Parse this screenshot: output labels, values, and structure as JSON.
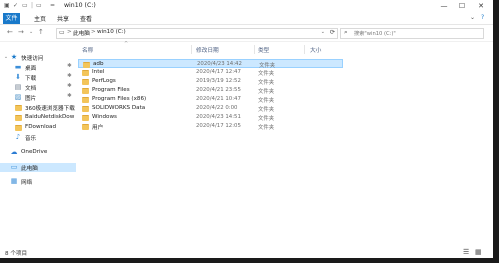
{
  "window": {
    "title": "win10 (C:)",
    "quick_access_icons": [
      "save-icon",
      "properties-icon",
      "new-folder-icon"
    ],
    "controls": {
      "minimize": "—",
      "maximize": "☐",
      "close": "✕"
    }
  },
  "ribbon": {
    "tabs": [
      "文件",
      "主页",
      "共享",
      "查看"
    ],
    "expand": "⌄",
    "help": "?"
  },
  "nav": {
    "back": "←",
    "forward": "→",
    "recent": "⌄",
    "up": "↑",
    "breadcrumb": [
      "此电脑",
      "win10 (C:)"
    ],
    "separator": ">",
    "dropdown": "⌄",
    "refresh": "⟳",
    "search_placeholder": "搜索\"win10 (C:)\""
  },
  "sidebar": {
    "items": [
      {
        "label": "快速访问",
        "icon": "star-icon",
        "pinned": false
      },
      {
        "label": "桌面",
        "icon": "desktop-icon",
        "pinned": true
      },
      {
        "label": "下载",
        "icon": "download-icon",
        "pinned": true
      },
      {
        "label": "文档",
        "icon": "document-icon",
        "pinned": true
      },
      {
        "label": "图片",
        "icon": "picture-icon",
        "pinned": true
      },
      {
        "label": "360极速浏览器下载",
        "icon": "folder-icon",
        "pinned": false
      },
      {
        "label": "BaiduNetdiskDow",
        "icon": "folder-icon",
        "pinned": false
      },
      {
        "label": "FDownload",
        "icon": "folder-icon",
        "pinned": false
      },
      {
        "label": "音乐",
        "icon": "music-icon",
        "pinned": false
      },
      {
        "label": "OneDrive",
        "icon": "onedrive-icon",
        "pinned": false
      },
      {
        "label": "此电脑",
        "icon": "pc-icon",
        "pinned": false,
        "selected": true
      },
      {
        "label": "网络",
        "icon": "network-icon",
        "pinned": false
      }
    ],
    "pin_glyph": "✱"
  },
  "columns": {
    "name": "名称",
    "date": "修改日期",
    "type": "类型",
    "size": "大小",
    "sort": "^"
  },
  "files": [
    {
      "name": "adb",
      "date": "2020/4/23 14:42",
      "type": "文件夹",
      "selected": true
    },
    {
      "name": "Intel",
      "date": "2020/4/17 12:47",
      "type": "文件夹"
    },
    {
      "name": "PerfLogs",
      "date": "2019/3/19 12:52",
      "type": "文件夹"
    },
    {
      "name": "Program Files",
      "date": "2020/4/21 23:55",
      "type": "文件夹"
    },
    {
      "name": "Program Files (x86)",
      "date": "2020/4/21 10:47",
      "type": "文件夹"
    },
    {
      "name": "SOLIDWORKS Data",
      "date": "2020/4/22 0:00",
      "type": "文件夹"
    },
    {
      "name": "Windows",
      "date": "2020/4/23 14:51",
      "type": "文件夹"
    },
    {
      "name": "用户",
      "date": "2020/4/17 12:05",
      "type": "文件夹"
    }
  ],
  "status": {
    "count": "8 个项目",
    "details_view": "☰",
    "icons_view": "▦"
  },
  "colors": {
    "file_tab": "#1979ca",
    "selection": "#cce8ff",
    "folder": "#f3c55a"
  }
}
